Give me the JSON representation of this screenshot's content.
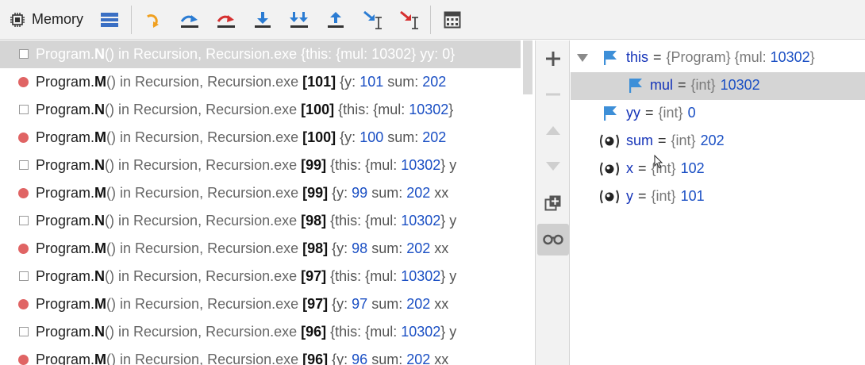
{
  "toolbar": {
    "memory_label": "Memory",
    "buttons": [
      {
        "name": "layout-icon"
      },
      {
        "name": "return-icon"
      },
      {
        "name": "step-over-icon"
      },
      {
        "name": "step-over-red-icon"
      },
      {
        "name": "step-into-icon"
      },
      {
        "name": "force-step-into-icon"
      },
      {
        "name": "step-out-icon"
      },
      {
        "name": "run-to-cursor-icon"
      },
      {
        "name": "run-to-cursor-red-icon"
      },
      {
        "name": "evaluate-icon"
      }
    ]
  },
  "frames": [
    {
      "marker": "square",
      "cls": "Program.",
      "meth": "N",
      "mod": "() in Recursion, Recursion.exe ",
      "depth": "",
      "args": "{this: {mul: 10302}  yy: 0}",
      "num": ""
    },
    {
      "marker": "dot",
      "cls": "Program.",
      "meth": "M",
      "mod": "() in Recursion, Recursion.exe ",
      "depth": "[101]",
      "args": " {y: ",
      "num": "101",
      "rest": "  sum: ",
      "num2": "202"
    },
    {
      "marker": "square",
      "cls": "Program.",
      "meth": "N",
      "mod": "() in Recursion, Recursion.exe ",
      "depth": "[100]",
      "args": " {this: {mul: ",
      "num": "10302",
      "rest": "}",
      "num2": ""
    },
    {
      "marker": "dot",
      "cls": "Program.",
      "meth": "M",
      "mod": "() in Recursion, Recursion.exe ",
      "depth": "[100]",
      "args": " {y: ",
      "num": "100",
      "rest": "  sum: ",
      "num2": "202"
    },
    {
      "marker": "square",
      "cls": "Program.",
      "meth": "N",
      "mod": "() in Recursion, Recursion.exe ",
      "depth": "[99]",
      "args": " {this: {mul: ",
      "num": "10302",
      "rest": "}  y",
      "num2": ""
    },
    {
      "marker": "dot",
      "cls": "Program.",
      "meth": "M",
      "mod": "() in Recursion, Recursion.exe ",
      "depth": "[99]",
      "args": " {y: ",
      "num": "99",
      "rest": "  sum: ",
      "num2": "202",
      "tail": "  xx"
    },
    {
      "marker": "square",
      "cls": "Program.",
      "meth": "N",
      "mod": "() in Recursion, Recursion.exe ",
      "depth": "[98]",
      "args": " {this: {mul: ",
      "num": "10302",
      "rest": "}  y",
      "num2": ""
    },
    {
      "marker": "dot",
      "cls": "Program.",
      "meth": "M",
      "mod": "() in Recursion, Recursion.exe ",
      "depth": "[98]",
      "args": " {y: ",
      "num": "98",
      "rest": "  sum: ",
      "num2": "202",
      "tail": "  xx"
    },
    {
      "marker": "square",
      "cls": "Program.",
      "meth": "N",
      "mod": "() in Recursion, Recursion.exe ",
      "depth": "[97]",
      "args": " {this: {mul: ",
      "num": "10302",
      "rest": "}  y",
      "num2": ""
    },
    {
      "marker": "dot",
      "cls": "Program.",
      "meth": "M",
      "mod": "() in Recursion, Recursion.exe ",
      "depth": "[97]",
      "args": " {y: ",
      "num": "97",
      "rest": "  sum: ",
      "num2": "202",
      "tail": "  xx"
    },
    {
      "marker": "square",
      "cls": "Program.",
      "meth": "N",
      "mod": "() in Recursion, Recursion.exe ",
      "depth": "[96]",
      "args": " {this: {mul: ",
      "num": "10302",
      "rest": "}  y",
      "num2": ""
    },
    {
      "marker": "dot",
      "cls": "Program.",
      "meth": "M",
      "mod": "() in Recursion, Recursion.exe ",
      "depth": "[96]",
      "args": " {y: ",
      "num": "96",
      "rest": "  sum: ",
      "num2": "202",
      "tail": "  xx"
    }
  ],
  "variables": [
    {
      "icon": "flag",
      "name": "this",
      "type": "{Program}",
      "extra": " {mul: ",
      "val": "10302",
      "close": "}"
    },
    {
      "icon": "flag",
      "name": "mul",
      "type": "{int}",
      "val": "10302"
    },
    {
      "icon": "flag",
      "name": "yy",
      "type": "{int}",
      "val": "0"
    },
    {
      "icon": "local",
      "name": "sum",
      "type": "{int}",
      "val": "202"
    },
    {
      "icon": "local",
      "name": "x",
      "type": "{int}",
      "val": "102"
    },
    {
      "icon": "local",
      "name": "y",
      "type": "{int}",
      "val": "101"
    }
  ],
  "colors": {
    "accent_blue": "#1a4fc4",
    "breakpoint_red": "#e06464",
    "selection_gray": "#d5d5d5"
  }
}
